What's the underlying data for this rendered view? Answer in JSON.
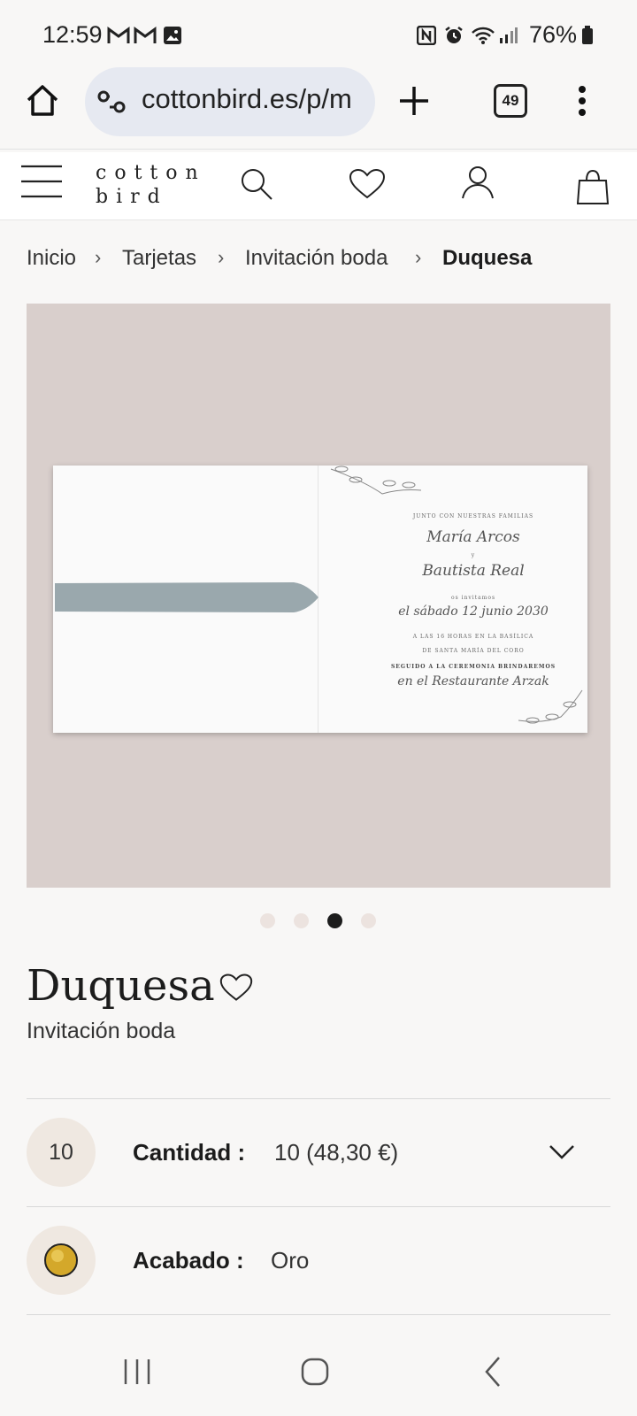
{
  "status_bar": {
    "time": "12:59",
    "battery": "76%",
    "left_icons": [
      "gmail-icon",
      "gmail-icon",
      "gallery-icon"
    ],
    "right_icons": [
      "nfc-icon",
      "alarm-icon",
      "wifi-icon",
      "signal-icon",
      "battery-icon"
    ]
  },
  "browser": {
    "url": "cottonbird.es/p/m",
    "tab_count": "49"
  },
  "site_header": {
    "logo_line1": "cotton",
    "logo_line2": "bird"
  },
  "breadcrumb": {
    "items": [
      "Inicio",
      "Tarjetas",
      "Invitación boda"
    ],
    "current": "Duquesa",
    "separator": "›"
  },
  "invitation_card": {
    "line1": "JUNTO CON NUESTRAS FAMILIAS",
    "name1": "María Arcos",
    "connector": "y",
    "name2": "Bautista Real",
    "line2": "os invitamos",
    "date": "el sábado 12 junio 2030",
    "line3": "A LAS 16 HORAS EN LA BASÍLICA",
    "line4": "DE SANTA MARÍA DEL CORO",
    "line5": "SEGUIDO A LA CEREMONIA BRINDAREMOS",
    "venue": "en el Restaurante Arzak"
  },
  "carousel": {
    "count": 4,
    "active_index": 2
  },
  "product": {
    "name": "Duquesa",
    "subtitle": "Invitación boda"
  },
  "options": {
    "quantity": {
      "badge": "10",
      "label": "Cantidad :",
      "value": "10 (48,30 €)"
    },
    "finish": {
      "label": "Acabado :",
      "value": "Oro",
      "swatch_color": "#d4a82a"
    }
  },
  "colors": {
    "accent_beige": "#efe8e1",
    "image_background": "#d9cfcc",
    "url_pill": "#e6e9f1"
  }
}
